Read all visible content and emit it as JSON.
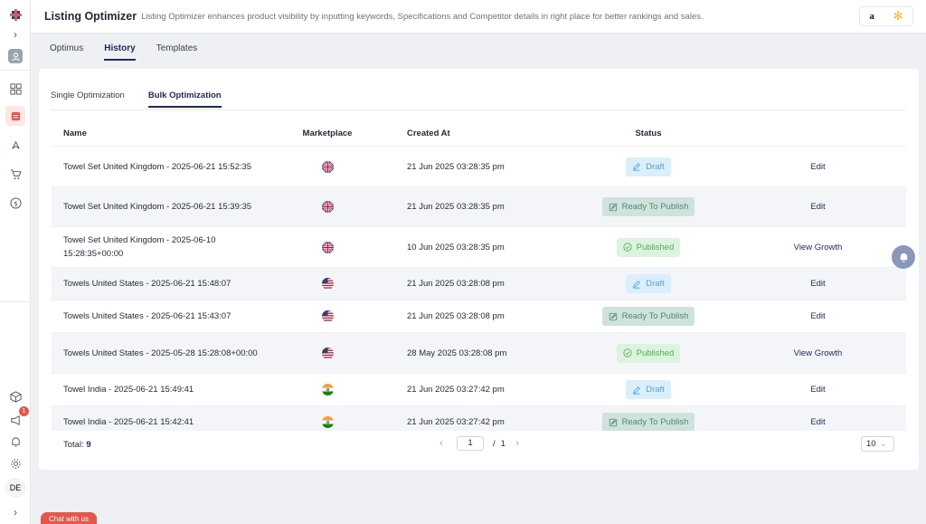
{
  "header": {
    "title": "Listing Optimizer",
    "subtitle": "Listing Optimizer enhances product visibility by inputting keywords, Specifications and Competitor details in right place for better rankings and sales.",
    "marketplaces": [
      "amazon",
      "walmart"
    ],
    "amazon_label": "a",
    "walmart_label": "✻"
  },
  "sidebar": {
    "avatar_label": "DE",
    "notification_count": "1",
    "icons": [
      "logo-icon",
      "expand-icon",
      "profile-icon",
      "dashboard-icon",
      "listing-optimizer-icon",
      "launch-icon",
      "cart-icon",
      "dollar-icon",
      "box-icon",
      "megaphone-icon",
      "bell-icon",
      "gear-icon",
      "collapse-icon"
    ]
  },
  "top_tabs": [
    {
      "label": "Optimus",
      "active": false
    },
    {
      "label": "History",
      "active": true
    },
    {
      "label": "Templates",
      "active": false
    }
  ],
  "sub_tabs": [
    {
      "label": "Single Optimization",
      "active": false
    },
    {
      "label": "Bulk Optimization",
      "active": true
    }
  ],
  "table": {
    "columns": [
      "Name",
      "Marketplace",
      "Created At",
      "Status",
      ""
    ],
    "rows": [
      {
        "name": "Towel Set United Kingdom - 2025-06-21 15:52:35",
        "marketplace": "uk",
        "created": "21 Jun 2025 03:28:35 pm",
        "status": "Draft",
        "action": "Edit"
      },
      {
        "name": "Towel Set United Kingdom - 2025-06-21 15:39:35",
        "marketplace": "uk",
        "created": "21 Jun 2025 03:28:35 pm",
        "status": "Ready To Publish",
        "action": "Edit"
      },
      {
        "name": "Towel Set United Kingdom - 2025-06-10 15:28:35+00:00",
        "marketplace": "uk",
        "created": "10 Jun 2025 03:28:35 pm",
        "status": "Published",
        "action": "View Growth"
      },
      {
        "name": "Towels United States - 2025-06-21 15:48:07",
        "marketplace": "us",
        "created": "21 Jun 2025 03:28:08 pm",
        "status": "Draft",
        "action": "Edit"
      },
      {
        "name": "Towels United States - 2025-06-21 15:43:07",
        "marketplace": "us",
        "created": "21 Jun 2025 03:28:08 pm",
        "status": "Ready To Publish",
        "action": "Edit"
      },
      {
        "name": "Towels United States - 2025-05-28 15:28:08+00:00",
        "marketplace": "us",
        "created": "28 May 2025 03:28:08 pm",
        "status": "Published",
        "action": "View Growth"
      },
      {
        "name": "Towel India - 2025-06-21 15:49:41",
        "marketplace": "in",
        "created": "21 Jun 2025 03:27:42 pm",
        "status": "Draft",
        "action": "Edit"
      },
      {
        "name": "Towel India - 2025-06-21 15:42:41",
        "marketplace": "in",
        "created": "21 Jun 2025 03:27:42 pm",
        "status": "Ready To Publish",
        "action": "Edit"
      }
    ]
  },
  "footer": {
    "total_label": "Total:",
    "total_value": "9",
    "page_current": "1",
    "page_separator": "/",
    "page_total": "1",
    "page_size": "10"
  },
  "chat_button": "Chat with us",
  "colors": {
    "accent": "#1e2a5a",
    "brand_red": "#e4574b",
    "draft": "#5aa0d8",
    "ready": "#4c8a73",
    "published": "#4caf50"
  }
}
